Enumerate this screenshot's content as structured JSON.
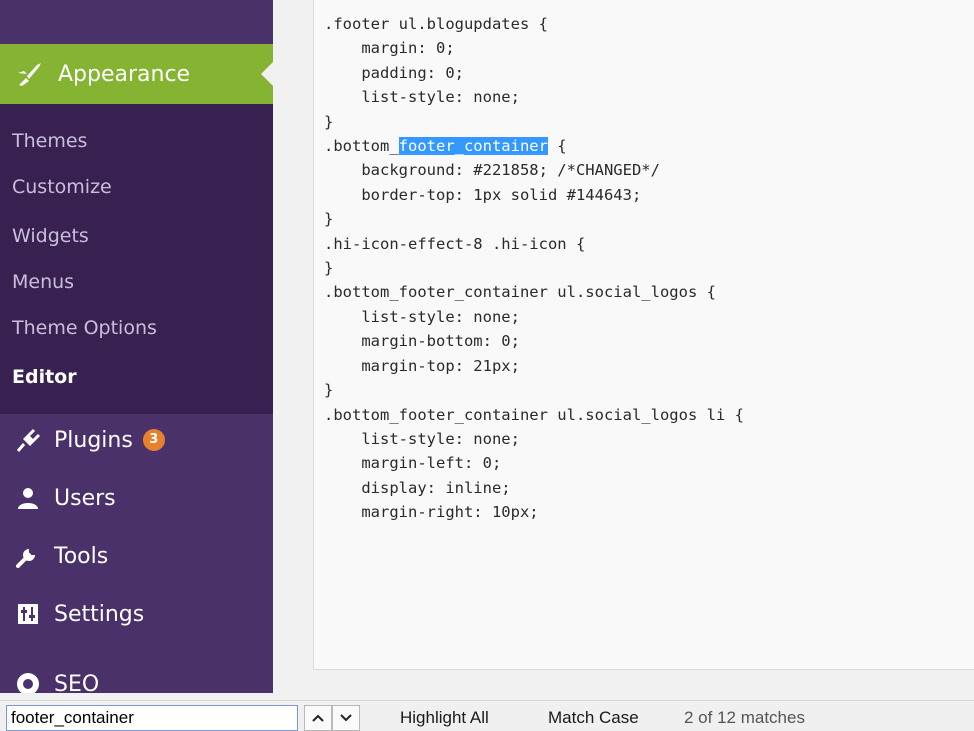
{
  "sidebar": {
    "appearance": {
      "label": "Appearance",
      "icon": "paintbrush-icon"
    },
    "submenu": [
      {
        "label": "Themes"
      },
      {
        "label": "Customize"
      },
      {
        "label": "Widgets"
      },
      {
        "label": "Menus"
      },
      {
        "label": "Theme Options"
      },
      {
        "label": "Editor",
        "current": true
      }
    ],
    "menu": [
      {
        "label": "Plugins",
        "icon": "plugin-icon",
        "badge": "3"
      },
      {
        "label": "Users",
        "icon": "users-icon"
      },
      {
        "label": "Tools",
        "icon": "wrench-icon"
      },
      {
        "label": "Settings",
        "icon": "settings-icon"
      },
      {
        "label": "SEO",
        "icon": "seo-icon"
      }
    ]
  },
  "editor": {
    "lines": [
      ".footer ul.blogupdates {",
      "    margin: 0;",
      "    padding: 0;",
      "    list-style: none;",
      "}",
      ".bottom_footer_container {",
      "    background: #221858; /*CHANGED*/",
      "    border-top: 1px solid #144643;",
      "}",
      ".hi-icon-effect-8 .hi-icon {",
      "}",
      ".bottom_footer_container ul.social_logos {",
      "    list-style: none;",
      "    margin-bottom: 0;",
      "    margin-top: 21px;",
      "}",
      ".bottom_footer_container ul.social_logos li {",
      "    list-style: none;",
      "    margin-left: 0;",
      "    display: inline;",
      "    margin-right: 10px;"
    ],
    "highlight": {
      "line": 5,
      "before": ".bottom_",
      "match": "footer_container",
      "after": " {"
    }
  },
  "findbar": {
    "query": "footer_container",
    "highlight_all_label": "Highlight All",
    "match_case_label": "Match Case",
    "status": "2 of 12 matches"
  },
  "colors": {
    "sidebar_bg": "#4b3169",
    "submenu_bg": "#382150",
    "accent": "#84b432",
    "badge": "#e6812e",
    "selection": "#3399ff"
  }
}
